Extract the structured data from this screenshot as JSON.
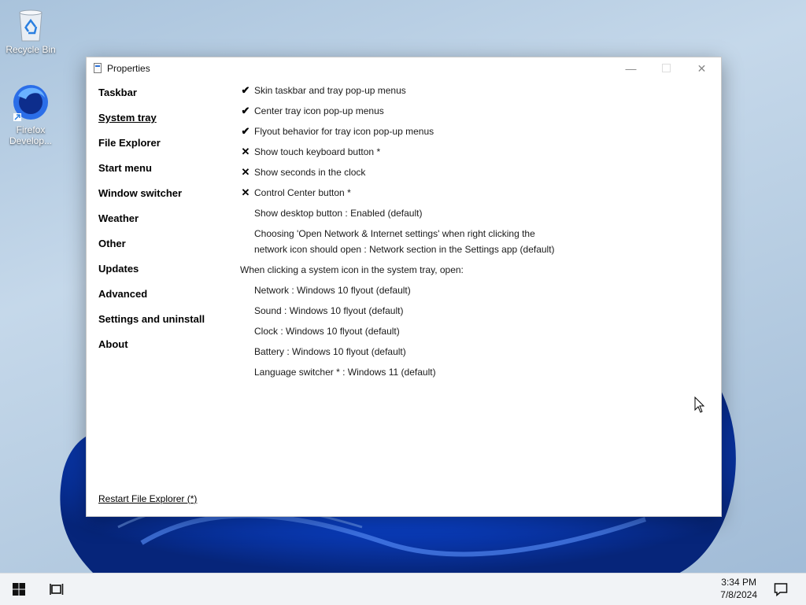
{
  "desktop": {
    "icons": [
      {
        "label": "Recycle Bin"
      },
      {
        "label": "Firefox Develop..."
      }
    ]
  },
  "window": {
    "title": "Properties",
    "controls": {
      "minimize": "—",
      "maximize": "☐",
      "close": "✕"
    }
  },
  "nav": {
    "items": [
      {
        "label": "Taskbar"
      },
      {
        "label": "System tray",
        "active": true
      },
      {
        "label": "File Explorer"
      },
      {
        "label": "Start menu"
      },
      {
        "label": "Window switcher"
      },
      {
        "label": "Weather"
      },
      {
        "label": "Other"
      },
      {
        "label": "Updates"
      },
      {
        "label": "Advanced"
      },
      {
        "label": "Settings and uninstall"
      },
      {
        "label": "About"
      }
    ]
  },
  "options": {
    "checks": [
      {
        "mark": "✔",
        "label": "Skin taskbar and tray pop-up menus"
      },
      {
        "mark": "✔",
        "label": "Center tray icon pop-up menus"
      },
      {
        "mark": "✔",
        "label": "Flyout behavior for tray icon pop-up menus"
      },
      {
        "mark": "✕",
        "label": "Show touch keyboard button *"
      },
      {
        "mark": "✕",
        "label": "Show seconds in the clock"
      },
      {
        "mark": "✕",
        "label": "Control Center button *"
      }
    ],
    "show_desktop": "Show desktop button : Enabled (default)",
    "network_settings_line1": "Choosing 'Open Network & Internet settings' when right clicking the",
    "network_settings_line2": "network icon should open : Network section in the Settings app (default)",
    "tray_click_heading": "When clicking a system icon in the system tray, open:",
    "tray_click_items": [
      "Network : Windows 10 flyout (default)",
      "Sound : Windows 10 flyout (default)",
      "Clock : Windows 10 flyout (default)",
      "Battery : Windows 10 flyout (default)",
      "Language switcher * : Windows 11 (default)"
    ]
  },
  "footer": {
    "restart": "Restart File Explorer (*)"
  },
  "taskbar": {
    "time": "3:34 PM",
    "date": "7/8/2024"
  }
}
